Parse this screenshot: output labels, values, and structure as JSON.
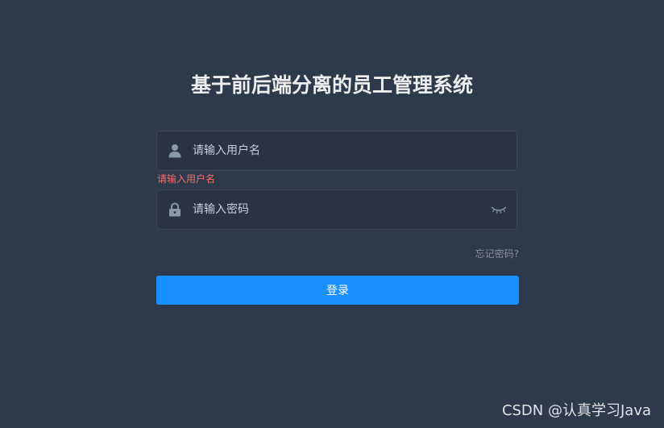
{
  "page": {
    "title": "基于前后端分离的员工管理系统",
    "background_color": "#2d3a4b"
  },
  "form": {
    "username": {
      "placeholder": "请输入用户名",
      "value": "",
      "error": "请输入用户名",
      "icon": "user-icon"
    },
    "password": {
      "placeholder": "请输入密码",
      "value": "",
      "icon": "lock-icon",
      "toggle_icon": "eye-closed-icon"
    },
    "forgot_password_label": "忘记密码?",
    "login_label": "登录"
  },
  "colors": {
    "primary": "#1890ff",
    "error": "#f56c6c",
    "input_background": "#283443"
  },
  "watermark": "CSDN @认真学习Java"
}
